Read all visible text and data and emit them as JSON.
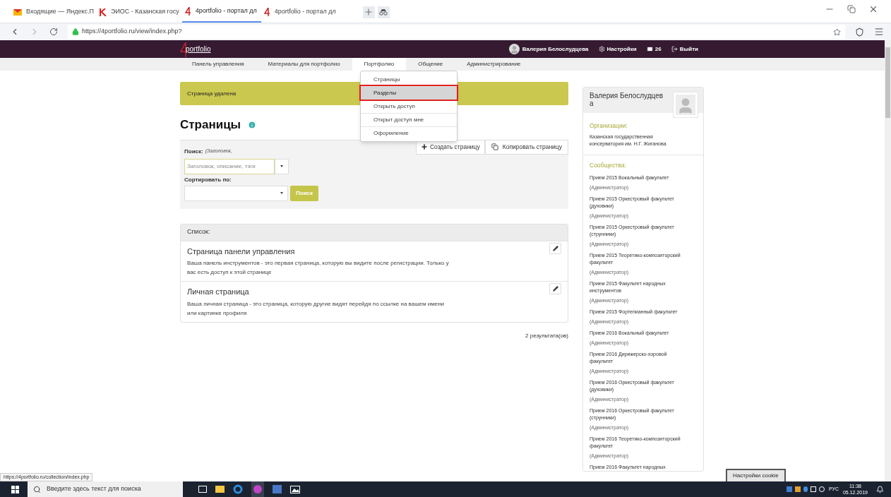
{
  "browser": {
    "tabs": [
      {
        "label": "Входящие — Яндекс.П",
        "kind": "mail",
        "selected": false
      },
      {
        "label": "ЭИОС - Казанская госу",
        "kind": "letter",
        "selected": false
      },
      {
        "label": "4portfolio - портал дл",
        "kind": "portfolio",
        "selected": true
      },
      {
        "label": "4portfolio - портал дл",
        "kind": "portfolio",
        "selected": false
      }
    ],
    "url": "https://4portfolio.ru/view/index.php?"
  },
  "header": {
    "logo": "portfolio",
    "user": "Валерия Белослудцева",
    "settings": "Настройки",
    "messages": "26",
    "logout": "Выйти"
  },
  "nav": [
    {
      "label": "Панель управления",
      "selected": false
    },
    {
      "label": "Материалы для портфолио",
      "selected": false
    },
    {
      "label": "Портфолио",
      "selected": true
    },
    {
      "label": "Общение",
      "selected": false
    },
    {
      "label": "Администрирование",
      "selected": false
    }
  ],
  "dropdown": [
    {
      "label": "Страницы",
      "selected": false
    },
    {
      "label": "Разделы",
      "selected": true
    },
    {
      "label": "Открыть доступ",
      "selected": false
    },
    {
      "label": "Открыт доступ мне",
      "selected": false
    },
    {
      "label": "Оформление",
      "selected": false
    }
  ],
  "alert": "Страница удалена",
  "title": "Страницы",
  "actions": {
    "create": "Создать страницу",
    "copy": "Копировать страницу"
  },
  "search": {
    "label": "Поиск:",
    "hint": "(Заголовок,",
    "placeholder": "Заголовок, описание, тэги",
    "sort_label": "Сортировать по:",
    "button": "Поиск"
  },
  "list": {
    "header": "Список:",
    "items": [
      {
        "title": "Страница панели управления",
        "description": "Ваша панель инструментов - это первая страница, которую вы видите после регистрации. Только у вас есть доступ к этой странице"
      },
      {
        "title": "Личная страница",
        "description": "Ваша личная страница - это страница, которую другие видят перейдя по ссылке на вашем имени или картинке профиля"
      }
    ],
    "results": "2 результата(ов)"
  },
  "sidebar": {
    "name": "Валерия Белослудцева",
    "organizations_heading": "Организации:",
    "organization": "Казанская государственная консерватория им. Н.Г. Жиганова",
    "communities_heading": "Сообщества:",
    "communities": [
      {
        "name": "Прием 2015 Вокальный факультет",
        "role": "(Администратор)"
      },
      {
        "name": "Прием 2015 Оркестровый факультет (духовики)",
        "role": "(Администратор)"
      },
      {
        "name": "Прием 2015 Оркестровый факультет (струнники)",
        "role": "(Администратор)"
      },
      {
        "name": "Прием 2015 Теоретико-композиторский факультет",
        "role": "(Администратор)"
      },
      {
        "name": "Прием 2015 Факультет народных инструментов",
        "role": "(Администратор)"
      },
      {
        "name": "Прием 2015 Фортепианный факультет",
        "role": "(Администратор)"
      },
      {
        "name": "Прием 2016 Вокальный факультет",
        "role": "(Администратор)"
      },
      {
        "name": "Прием 2016 Дирижерско-хоровой факультет",
        "role": "(Администратор)"
      },
      {
        "name": "Прием 2016 Оркестровый факультет (духовики)",
        "role": "(Администратор)"
      },
      {
        "name": "Прием 2016 Оркестровый факультет (струнники)",
        "role": "(Администратор)"
      },
      {
        "name": "Прием 2016 Теоретико-композиторский факультет",
        "role": "(Администратор)"
      },
      {
        "name": "Прием 2016 Факультет народных"
      }
    ]
  },
  "status_url": "https://4portfolio.ru/collection/index.php",
  "cookie_button": "Настройки cookie",
  "taskbar": {
    "search_placeholder": "Введите здесь текст для поиска",
    "language": "РУС",
    "time": "11:38",
    "date": "05.12.2019"
  }
}
